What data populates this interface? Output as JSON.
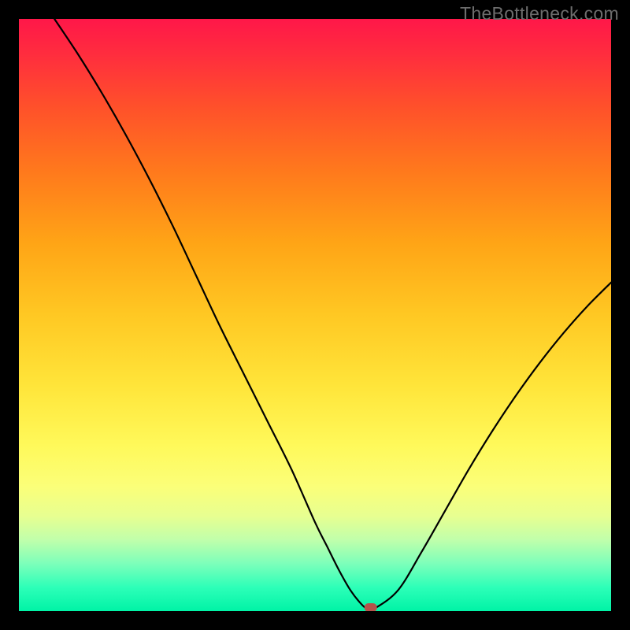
{
  "watermark": "TheBottleneck.com",
  "chart_data": {
    "type": "line",
    "title": "",
    "xlabel": "",
    "ylabel": "",
    "x_range": [
      0,
      100
    ],
    "y_range": [
      0,
      100
    ],
    "legend": false,
    "grid": false,
    "background_gradient": {
      "top_color": "#ff1749",
      "mid_color": "#ffe53a",
      "bottom_color": "#00f3a6"
    },
    "series": [
      {
        "name": "bottleneck-curve",
        "x": [
          6,
          10,
          14,
          18,
          22,
          26,
          30,
          34,
          38,
          42,
          46,
          50,
          52,
          54,
          56,
          58,
          59,
          60,
          64,
          68,
          72,
          76,
          80,
          84,
          88,
          92,
          96,
          100
        ],
        "y": [
          100,
          94,
          87.5,
          80.5,
          73,
          65,
          56.5,
          48,
          40,
          32,
          24,
          15,
          11,
          7,
          3.5,
          1,
          0.4,
          0.4,
          3.5,
          10,
          17,
          24,
          30.5,
          36.5,
          42,
          47,
          51.5,
          55.5
        ]
      }
    ],
    "marker": {
      "name": "optimal-point",
      "x": 59.4,
      "y": 0.6,
      "shape": "rounded-rect",
      "color": "#b6524a"
    },
    "gradient_zones_note": "Color indicates bottleneck severity: green=balanced (~0%), yellow=moderate (~50%), red=severe (~100%)."
  }
}
